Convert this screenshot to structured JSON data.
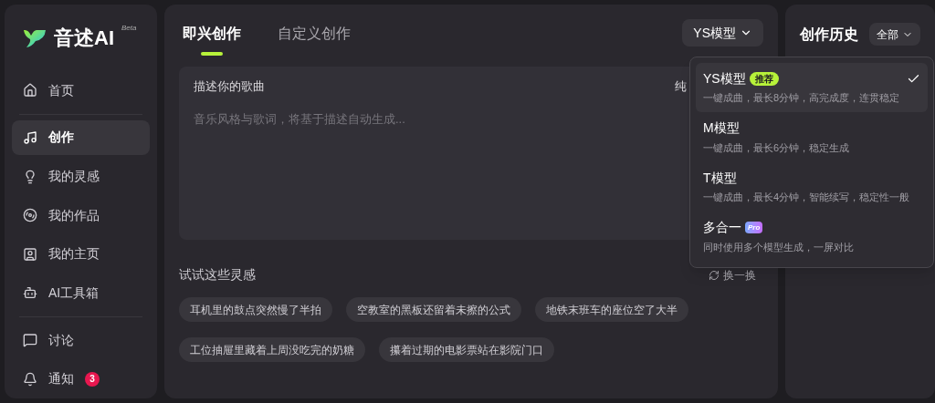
{
  "sidebar": {
    "logo": {
      "name": "音述AI",
      "badge": "Beta"
    },
    "groups": [
      [
        {
          "label": "首页",
          "selected": false
        }
      ],
      [
        {
          "label": "创作",
          "selected": true
        },
        {
          "label": "我的灵感",
          "selected": false
        },
        {
          "label": "我的作品",
          "selected": false
        },
        {
          "label": "我的主页",
          "selected": false
        },
        {
          "label": "AI工具箱",
          "selected": false
        }
      ],
      [
        {
          "label": "讨论",
          "selected": false
        },
        {
          "label": "通知",
          "selected": false,
          "count": "3"
        }
      ]
    ]
  },
  "main": {
    "tabs": [
      {
        "label": "即兴创作",
        "selected": true
      },
      {
        "label": "自定义创作",
        "selected": false
      }
    ],
    "model_button": "YS模型",
    "prompt": {
      "label": "描述你的歌曲",
      "placeholder": "音乐风格与歌词，将基于描述自动生成...",
      "toggle_label": "纯"
    },
    "inspiration": {
      "title": "试试这些灵感",
      "refresh": "换一换",
      "chips": [
        "耳机里的鼓点突然慢了半拍",
        "空教室的黑板还留着未擦的公式",
        "地铁末班车的座位空了大半",
        "工位抽屉里藏着上周没吃完的奶糖",
        "攥着过期的电影票站在影院门口"
      ]
    },
    "model_menu": [
      {
        "kind": "recommended",
        "name": "YS模型",
        "tag": "推荐",
        "description": "一键成曲，最长8分钟，高完成度，连贯稳定",
        "selected": true
      },
      {
        "kind": "plain",
        "name": "M模型",
        "description": "一键成曲，最长6分钟，稳定生成",
        "selected": false
      },
      {
        "kind": "plain",
        "name": "T模型",
        "description": "一键成曲，最长4分钟，智能续写，稳定性一般",
        "selected": false
      },
      {
        "kind": "pro",
        "name": "多合一",
        "tag": "Pro",
        "description": "同时使用多个模型生成，一屏对比",
        "selected": false
      }
    ]
  },
  "history": {
    "title": "创作历史",
    "filter": "全部"
  }
}
